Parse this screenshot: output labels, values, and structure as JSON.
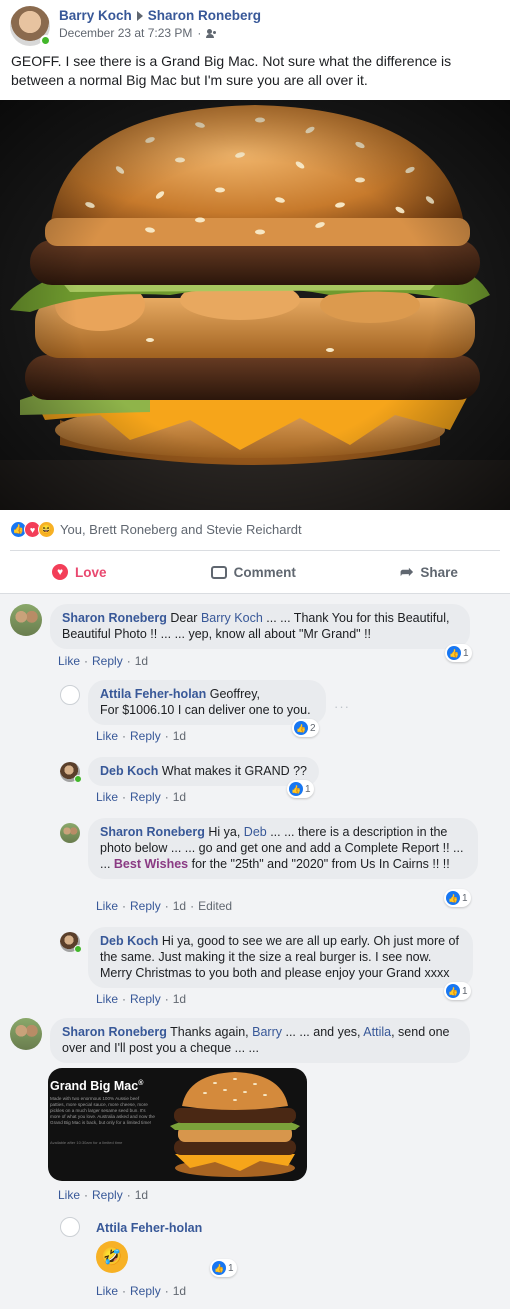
{
  "post": {
    "author": "Barry Koch",
    "recipient": "Sharon Roneberg",
    "timestamp": "December 23 at 7:23 PM",
    "privacy_icon": "friends-icon",
    "text": "GEOFF. I see there is a Grand Big Mac. Not sure what the difference is between a normal Big Mac but I'm sure you are all over it.",
    "image_icon": "burger-photo",
    "reactions": {
      "icons": [
        "like-icon",
        "love-icon",
        "haha-icon"
      ],
      "names": "You, Brett Roneberg and Stevie Reichardt"
    },
    "actions": {
      "love": "Love",
      "comment": "Comment",
      "share": "Share"
    }
  },
  "comments": [
    {
      "author": "Sharon Roneberg",
      "parts": [
        "Dear ",
        "Barry Koch",
        " ... ... Thank You for this Beautiful, Beautiful Photo !! ... ... yep, know all about \"Mr Grand\" !!"
      ],
      "likes": "1",
      "time": "1d"
    },
    {
      "author": "Attila Feher-holan",
      "text1": "Geoffrey,",
      "text2": "For $1006.10 I can deliver one to you.",
      "likes": "2",
      "time": "1d",
      "more": "···"
    },
    {
      "author": "Deb Koch",
      "text": "What makes it GRAND ??",
      "likes": "1",
      "time": "1d"
    },
    {
      "author": "Sharon Roneberg",
      "parts": [
        "Hi ya, ",
        "Deb",
        " ... ... there is a description in the photo below ... ... go and get one and add a Complete Report !! ... ... ",
        "Best Wishes",
        " for the \"25th\" and \"2020\" from Us In Cairns !! !!"
      ],
      "likes": "1",
      "time": "1d",
      "edited": "Edited"
    },
    {
      "author": "Deb Koch",
      "text": "Hi ya, good to see we are all up early. Oh just more of the same. Just making it the size a real burger is. I see now. Merry Christmas to you both and please enjoy your Grand xxxx",
      "likes": "1",
      "time": "1d"
    },
    {
      "author": "Sharon Roneberg",
      "parts": [
        "Thanks again, ",
        "Barry",
        " ... ... and yes, ",
        "Attila",
        ", send one over and I'll post you a cheque ... ..."
      ],
      "attachment_title": "Grand Big Mac",
      "attachment_tm": "®",
      "attachment_body": "Made with two enormous 100% Aussie beef patties, more special sauce, more cheese, more pickles on a much larger sesame seed bun. It's more of what you love. Australia asked and now the Grand Big Mac is back, but only for a limited time!",
      "attachment_fine": "Available after 10:30am for a limited time",
      "time": "1d"
    },
    {
      "author": "Attila Feher-holan",
      "emoji": "rolling-on-floor-laughing-emoji",
      "emoji_char": "🤣",
      "likes": "1",
      "time": "1d"
    }
  ],
  "labels": {
    "like": "Like",
    "reply": "Reply",
    "dot": "·"
  },
  "colors": {
    "link": "#385898",
    "love": "#e9486f",
    "like": "#1877f2",
    "purple": "#8a3a83"
  }
}
